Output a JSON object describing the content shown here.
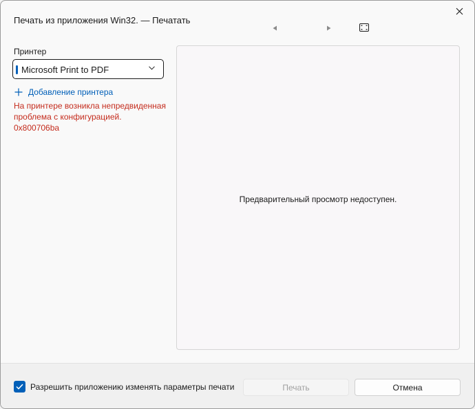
{
  "window": {
    "title": "Печать из приложения Win32. — Печатать"
  },
  "toolbar": {
    "close_icon": "close-icon",
    "prev_icon": "triangle-left-icon",
    "next_icon": "triangle-right-icon",
    "fit_icon": "fit-page-icon"
  },
  "sidebar": {
    "printer_label": "Принтер",
    "printer_selected": "Microsoft Print to PDF",
    "add_printer_label": "Добавление принтера",
    "error_text": "На принтере возникла непредвиденная проблема с конфигурацией. 0x800706ba"
  },
  "preview": {
    "message": "Предварительный просмотр недоступен."
  },
  "footer": {
    "allow_label": "Разрешить приложению изменять параметры печати",
    "allow_checked": true,
    "print_label": "Печать",
    "cancel_label": "Отмена"
  },
  "colors": {
    "accent": "#005fb8",
    "error": "#c42b1c"
  }
}
